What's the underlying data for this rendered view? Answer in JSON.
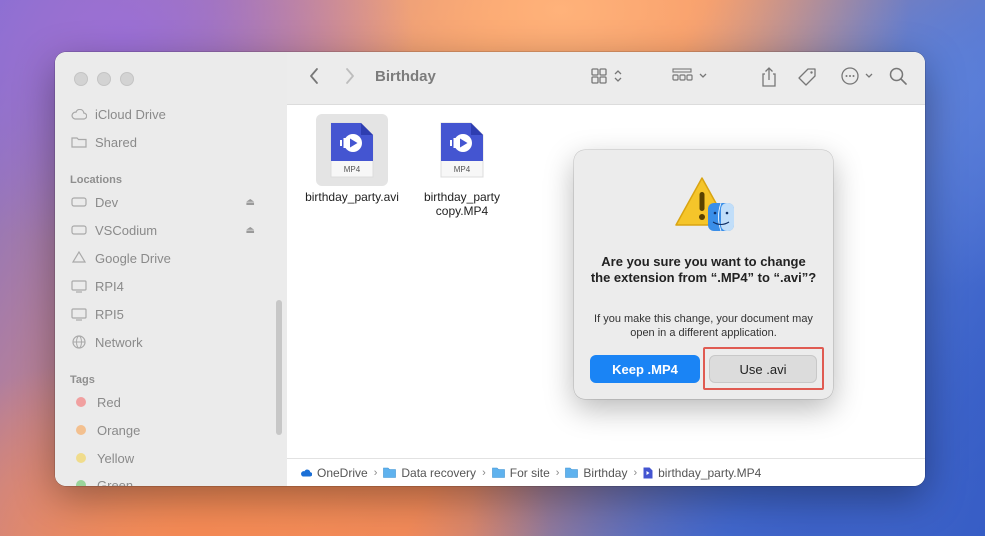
{
  "sidebar": {
    "items_top": [
      {
        "label": "iCloud Drive",
        "icon": "cloud-icon"
      },
      {
        "label": "Shared",
        "icon": "shared-folder-icon"
      }
    ],
    "locations_header": "Locations",
    "locations": [
      {
        "label": "Dev",
        "icon": "drive-icon",
        "eject": true
      },
      {
        "label": "VSCodium",
        "icon": "drive-icon",
        "eject": true
      },
      {
        "label": "Google Drive",
        "icon": "google-drive-icon",
        "eject": false
      },
      {
        "label": "RPI4",
        "icon": "display-icon",
        "eject": false
      },
      {
        "label": "RPI5",
        "icon": "display-icon",
        "eject": false
      },
      {
        "label": "Network",
        "icon": "network-icon",
        "eject": false
      }
    ],
    "tags_header": "Tags",
    "tags": [
      {
        "label": "Red",
        "color": "#f1a0a0"
      },
      {
        "label": "Orange",
        "color": "#f3c08f"
      },
      {
        "label": "Yellow",
        "color": "#f0dc8c"
      },
      {
        "label": "Green",
        "color": "#9ad49a"
      }
    ]
  },
  "toolbar": {
    "title": "Birthday"
  },
  "files": [
    {
      "name": "birthday_party.avi",
      "badge": "MP4",
      "selected": true
    },
    {
      "name_line1": "birthday_party",
      "name_line2": "copy.MP4",
      "badge": "MP4",
      "selected": false
    }
  ],
  "dialog": {
    "title": "Are you sure you want to change the extension from “.MP4” to “.avi”?",
    "message": "If you make this change, your document may open in a different application.",
    "primary_button": "Keep .MP4",
    "secondary_button": "Use .avi",
    "accent": "#1a84f5",
    "highlight_color": "#e05b52"
  },
  "pathbar": {
    "crumbs": [
      "OneDrive",
      "Data recovery",
      "For site",
      "Birthday",
      "birthday_party.MP4"
    ]
  }
}
